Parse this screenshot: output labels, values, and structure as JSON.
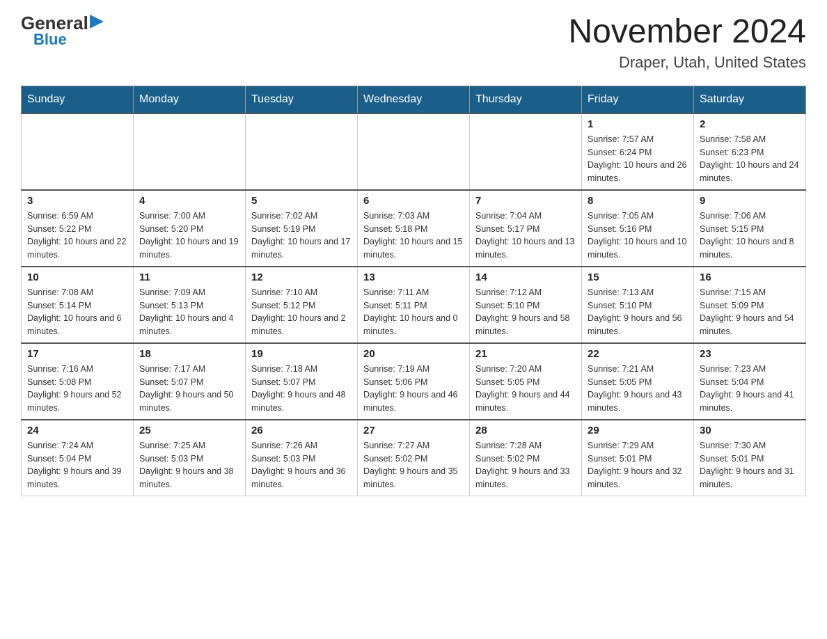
{
  "logo": {
    "general": "General",
    "blue": "Blue",
    "arrow": "▶"
  },
  "title": "November 2024",
  "location": "Draper, Utah, United States",
  "weekdays": [
    "Sunday",
    "Monday",
    "Tuesday",
    "Wednesday",
    "Thursday",
    "Friday",
    "Saturday"
  ],
  "weeks": [
    [
      {
        "day": "",
        "info": ""
      },
      {
        "day": "",
        "info": ""
      },
      {
        "day": "",
        "info": ""
      },
      {
        "day": "",
        "info": ""
      },
      {
        "day": "",
        "info": ""
      },
      {
        "day": "1",
        "info": "Sunrise: 7:57 AM\nSunset: 6:24 PM\nDaylight: 10 hours and 26 minutes."
      },
      {
        "day": "2",
        "info": "Sunrise: 7:58 AM\nSunset: 6:23 PM\nDaylight: 10 hours and 24 minutes."
      }
    ],
    [
      {
        "day": "3",
        "info": "Sunrise: 6:59 AM\nSunset: 5:22 PM\nDaylight: 10 hours and 22 minutes."
      },
      {
        "day": "4",
        "info": "Sunrise: 7:00 AM\nSunset: 5:20 PM\nDaylight: 10 hours and 19 minutes."
      },
      {
        "day": "5",
        "info": "Sunrise: 7:02 AM\nSunset: 5:19 PM\nDaylight: 10 hours and 17 minutes."
      },
      {
        "day": "6",
        "info": "Sunrise: 7:03 AM\nSunset: 5:18 PM\nDaylight: 10 hours and 15 minutes."
      },
      {
        "day": "7",
        "info": "Sunrise: 7:04 AM\nSunset: 5:17 PM\nDaylight: 10 hours and 13 minutes."
      },
      {
        "day": "8",
        "info": "Sunrise: 7:05 AM\nSunset: 5:16 PM\nDaylight: 10 hours and 10 minutes."
      },
      {
        "day": "9",
        "info": "Sunrise: 7:06 AM\nSunset: 5:15 PM\nDaylight: 10 hours and 8 minutes."
      }
    ],
    [
      {
        "day": "10",
        "info": "Sunrise: 7:08 AM\nSunset: 5:14 PM\nDaylight: 10 hours and 6 minutes."
      },
      {
        "day": "11",
        "info": "Sunrise: 7:09 AM\nSunset: 5:13 PM\nDaylight: 10 hours and 4 minutes."
      },
      {
        "day": "12",
        "info": "Sunrise: 7:10 AM\nSunset: 5:12 PM\nDaylight: 10 hours and 2 minutes."
      },
      {
        "day": "13",
        "info": "Sunrise: 7:11 AM\nSunset: 5:11 PM\nDaylight: 10 hours and 0 minutes."
      },
      {
        "day": "14",
        "info": "Sunrise: 7:12 AM\nSunset: 5:10 PM\nDaylight: 9 hours and 58 minutes."
      },
      {
        "day": "15",
        "info": "Sunrise: 7:13 AM\nSunset: 5:10 PM\nDaylight: 9 hours and 56 minutes."
      },
      {
        "day": "16",
        "info": "Sunrise: 7:15 AM\nSunset: 5:09 PM\nDaylight: 9 hours and 54 minutes."
      }
    ],
    [
      {
        "day": "17",
        "info": "Sunrise: 7:16 AM\nSunset: 5:08 PM\nDaylight: 9 hours and 52 minutes."
      },
      {
        "day": "18",
        "info": "Sunrise: 7:17 AM\nSunset: 5:07 PM\nDaylight: 9 hours and 50 minutes."
      },
      {
        "day": "19",
        "info": "Sunrise: 7:18 AM\nSunset: 5:07 PM\nDaylight: 9 hours and 48 minutes."
      },
      {
        "day": "20",
        "info": "Sunrise: 7:19 AM\nSunset: 5:06 PM\nDaylight: 9 hours and 46 minutes."
      },
      {
        "day": "21",
        "info": "Sunrise: 7:20 AM\nSunset: 5:05 PM\nDaylight: 9 hours and 44 minutes."
      },
      {
        "day": "22",
        "info": "Sunrise: 7:21 AM\nSunset: 5:05 PM\nDaylight: 9 hours and 43 minutes."
      },
      {
        "day": "23",
        "info": "Sunrise: 7:23 AM\nSunset: 5:04 PM\nDaylight: 9 hours and 41 minutes."
      }
    ],
    [
      {
        "day": "24",
        "info": "Sunrise: 7:24 AM\nSunset: 5:04 PM\nDaylight: 9 hours and 39 minutes."
      },
      {
        "day": "25",
        "info": "Sunrise: 7:25 AM\nSunset: 5:03 PM\nDaylight: 9 hours and 38 minutes."
      },
      {
        "day": "26",
        "info": "Sunrise: 7:26 AM\nSunset: 5:03 PM\nDaylight: 9 hours and 36 minutes."
      },
      {
        "day": "27",
        "info": "Sunrise: 7:27 AM\nSunset: 5:02 PM\nDaylight: 9 hours and 35 minutes."
      },
      {
        "day": "28",
        "info": "Sunrise: 7:28 AM\nSunset: 5:02 PM\nDaylight: 9 hours and 33 minutes."
      },
      {
        "day": "29",
        "info": "Sunrise: 7:29 AM\nSunset: 5:01 PM\nDaylight: 9 hours and 32 minutes."
      },
      {
        "day": "30",
        "info": "Sunrise: 7:30 AM\nSunset: 5:01 PM\nDaylight: 9 hours and 31 minutes."
      }
    ]
  ]
}
